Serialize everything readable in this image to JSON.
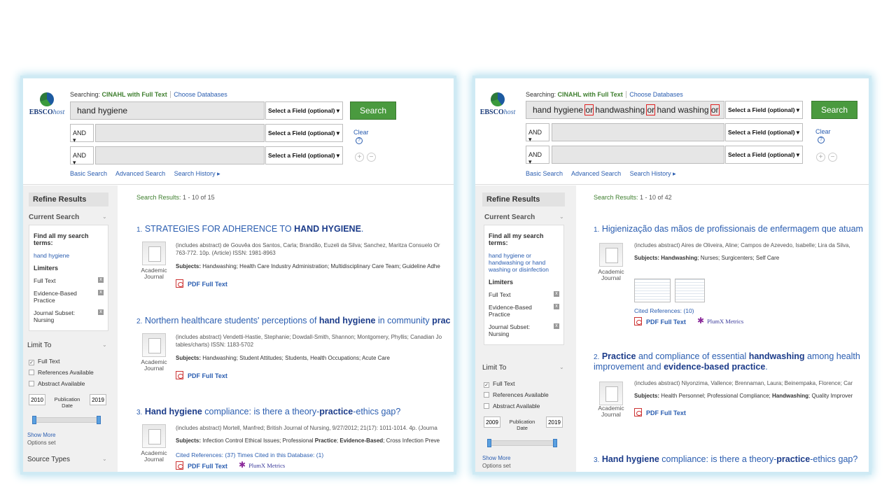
{
  "common": {
    "logo": {
      "ebsco": "EBSCO",
      "host": "host"
    },
    "searching_label": "Searching:",
    "database": "CINAHL with Full Text",
    "choose_databases": "Choose Databases",
    "field_select": "Select a Field (optional) ▾",
    "bool_and": "AND ▾",
    "search_button": "Search",
    "clear": "Clear",
    "help": "?",
    "plus": "+",
    "minus": "−",
    "links": {
      "basic": "Basic Search",
      "advanced": "Advanced Search",
      "history": "Search History ▸"
    },
    "refine_results": "Refine Results",
    "current_search": "Current Search",
    "find_all_terms": "Find all my search terms:",
    "limiters": "Limiters",
    "limiter_items": [
      "Full Text",
      "Evidence-Based Practice",
      "Journal Subset: Nursing"
    ],
    "remove_glyph": "x",
    "limit_to": "Limit To",
    "limit_checks": [
      "Full Text",
      "References Available",
      "Abstract Available"
    ],
    "check_mark": "✓",
    "pub_date": "Publication Date",
    "show_more": "Show More",
    "options_set": "Options set",
    "source_types": "Source Types",
    "results_label": "Search Results:",
    "academic_journal": "Academic Journal",
    "subjects_label": "Subjects:",
    "pdf_full_text": "PDF Full Text",
    "plumx": "PlumX Metrics"
  },
  "left": {
    "query": "hand hygiene",
    "search_term": "hand hygiene",
    "year_from": "2010",
    "year_to": "2019",
    "results_count": "1 - 10 of 15",
    "results": [
      {
        "num": "1.",
        "title_parts": [
          "STRATEGIES FOR ADHERENCE TO ",
          "HAND HYGIENE",
          "."
        ],
        "meta1": "(includes abstract) de Gouvêa dos Santos, Carla; Brandão, Euzeli da Silva; Sanchez, Maritza Consuelo Or",
        "meta2": "763-772. 10p. (Article) ISSN: 1981-8963",
        "subjects": "Handwashing; Health Care Industry Administration; Multidisciplinary Care Team; Guideline Adhe"
      },
      {
        "num": "2.",
        "title_parts": [
          "Northern healthcare students' perceptions of ",
          "hand hygiene",
          " in community ",
          "prac"
        ],
        "meta1": "(includes abstract) Vendetti-Hastie, Stephanie; Dowdall-Smith, Shannon; Montgomery, Phyllis; Canadian Jo",
        "meta2": "tables/charts) ISSN: 1183-5702",
        "subjects": "Handwashing; Student Attitudes; Students, Health Occupations; Acute Care"
      },
      {
        "num": "3.",
        "title_parts": [
          "Hand hygiene",
          " compliance: is there a theory-",
          "practice",
          "-ethics gap?"
        ],
        "meta1": "(includes abstract) Mortell, Manfred; British Journal of Nursing, 9/27/2012; 21(17): 1011-1014. 4p. (Journa",
        "subjects_parts": [
          "Infection Control Ethical Issues; Professional ",
          "Practice",
          "; ",
          "Evidence-Based",
          "; Cross Infection Preve"
        ],
        "cited": "Cited References: (37) Times Cited in this Database: (1)"
      }
    ]
  },
  "right": {
    "query_parts": [
      "hand hygiene ",
      "or",
      " handwashing ",
      "or",
      " hand washing ",
      "or"
    ],
    "search_term": "hand hygiene or handwashing or hand washing or disinfection",
    "year_from": "2009",
    "year_to": "2019",
    "results_count": "1 - 10 of 42",
    "results": [
      {
        "num": "1.",
        "title": "Higienização das mãos de profissionais de enfermagem que atuam",
        "meta1": "(includes abstract) Aires de Oliveira, Aline; Campos de Azevedo, Isabelle; Lira da Silva,",
        "subjects_parts": [
          "Handwashing",
          "; Nurses; Surgicenters; Self Care"
        ],
        "cited": "Cited References: (10)"
      },
      {
        "num": "2.",
        "title_parts": [
          "Practice",
          " and compliance of essential ",
          "handwashing",
          " among health"
        ],
        "title_line2_parts": [
          "improvement and ",
          "evidence-based practice",
          "."
        ],
        "meta1": "(includes abstract) Niyonzima, Vallence; Brennaman, Laura; Beinempaka, Florence; Car",
        "subjects_parts": [
          "Health Personnel; Professional Compliance; ",
          "Handwashing",
          "; Quality Improver"
        ]
      },
      {
        "num": "3.",
        "title_parts": [
          "Hand hygiene",
          " compliance: is there a theory-",
          "practice",
          "-ethics gap?"
        ]
      }
    ]
  }
}
